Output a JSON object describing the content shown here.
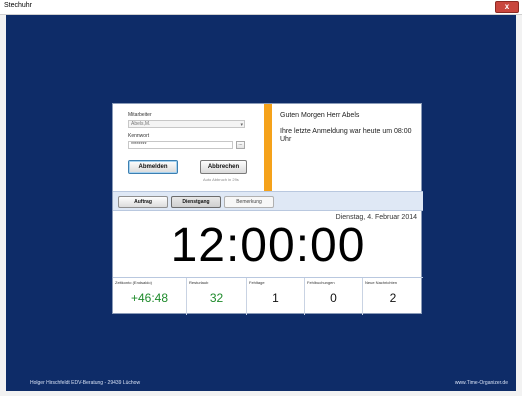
{
  "window": {
    "title": "Stechuhr",
    "close_symbol": "x"
  },
  "login": {
    "employee_label": "Mitarbeiter",
    "employee_value": "Abels,M.",
    "password_label": "Kennwort",
    "password_value": "********",
    "browse_button": "...",
    "logout_button": "Abmelden",
    "cancel_button": "Abbrechen",
    "auto_cancel_note": "Auto Abbruch in 29s"
  },
  "greeting": {
    "headline": "Guten Morgen Herr Abels",
    "last_login": "Ihre letzte Anmeldung war heute um 08:00 Uhr"
  },
  "tabs": [
    {
      "label": "Auftrag"
    },
    {
      "label": "Dienstgang"
    },
    {
      "label": "Bemerkung"
    }
  ],
  "clock": {
    "date": "Dienstag, 4. Februar 2014",
    "time": "12:00:00"
  },
  "stats": [
    {
      "label": "Zeitkonto (Endsaldo)",
      "value": "+46:48"
    },
    {
      "label": "Resturlaub",
      "value": "32"
    },
    {
      "label": "Fehltage",
      "value": "1"
    },
    {
      "label": "Fehlbuchungen",
      "value": "0"
    },
    {
      "label": "Neue Nachrichten",
      "value": "2"
    }
  ],
  "footer": {
    "left": "Holger Hirschfeldt EDV-Beratung - 29439 Lüchow",
    "right": "www.Time-Organizer.de"
  },
  "colors": {
    "background": "#0e2c68",
    "accent": "#f5a21a",
    "positive": "#1d8a2a"
  }
}
